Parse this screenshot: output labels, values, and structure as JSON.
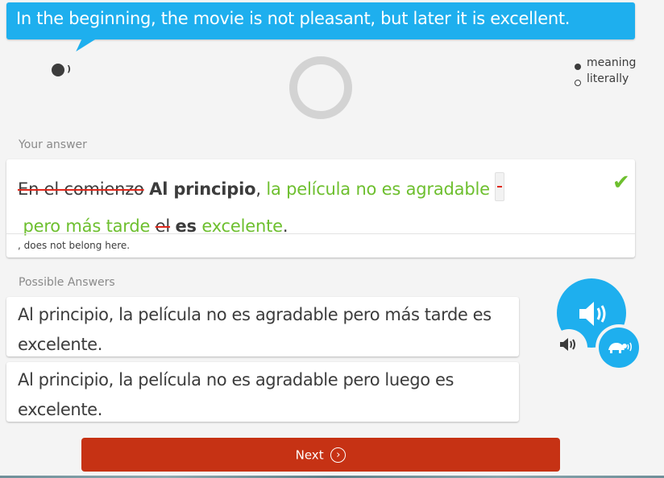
{
  "prompt": {
    "text": "In the beginning, the movie is not pleasant, but later it is excellent.",
    "speaker_icon": "speaker-icon"
  },
  "progress_ring": {
    "icon": "progress-ring-icon"
  },
  "translation_mode": {
    "options": [
      {
        "label": "meaning",
        "selected": true
      },
      {
        "label": "literally",
        "selected": false
      }
    ]
  },
  "your_answer": {
    "label": "Your answer",
    "tokens": [
      {
        "text": "En el comienzo",
        "type": "wrong"
      },
      {
        "text": " ",
        "type": "space"
      },
      {
        "text": "Al principio",
        "type": "missing"
      },
      {
        "text": ", ",
        "type": "plain"
      },
      {
        "text": "la película no es agradable",
        "type": "correct"
      },
      {
        "text": " ",
        "type": "space"
      },
      {
        "text": ",",
        "type": "extra"
      },
      {
        "text": " pero más tarde",
        "type": "correct"
      },
      {
        "text": " ",
        "type": "space"
      },
      {
        "text": "el",
        "type": "wrong"
      },
      {
        "text": " ",
        "type": "space"
      },
      {
        "text": "es",
        "type": "missing"
      },
      {
        "text": " ",
        "type": "space"
      },
      {
        "text": "excelente",
        "type": "correct"
      },
      {
        "text": ".",
        "type": "plain"
      }
    ],
    "status_icon": "checkmark-icon",
    "feedback": ", does not belong here."
  },
  "possible_answers": {
    "label": "Possible Answers",
    "items": [
      "Al principio, la película no es agradable pero más tarde es excelente.",
      "Al principio, la película no es agradable pero luego es excelente."
    ]
  },
  "audio": {
    "play_icon": "speaker-icon",
    "slow_icon": "turtle-icon"
  },
  "colors": {
    "accent_blue": "#1eafee",
    "correct_green": "#6dbf2e",
    "error_red": "#e0271b",
    "next_button": "#c63214"
  },
  "next_button": {
    "label": "Next"
  }
}
